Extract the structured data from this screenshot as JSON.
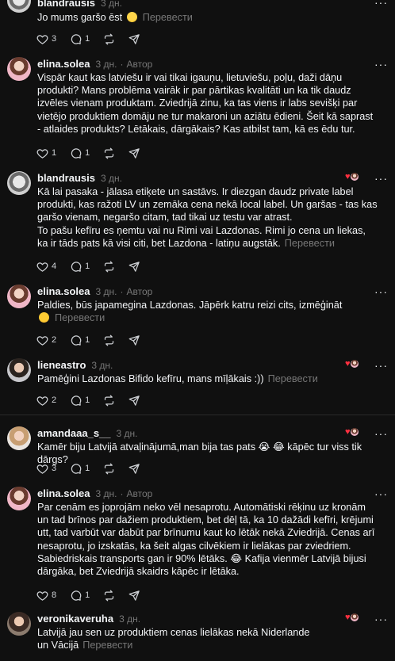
{
  "comments": [
    {
      "username": "blandrausis",
      "time": "3 дн.",
      "text": "Jo mums garšo ēst 🥹",
      "translate": "Перевести",
      "likes": "3",
      "replies": "1",
      "liked_by_author": false
    },
    {
      "username": "elina.solea",
      "time": "3 дн.",
      "author_tag": "Автор",
      "text": "Vispār kaut kas latviešu ir vai tikai igauņu, lietuviešu, poļu, daži dāņu produkti? Mans problēma vairāk ir par pārtikas kvalitāti un ka tik daudz izvēles vienam produktam. Zviedrijā zinu, ka tas viens ir labs sevišķi par vietējo produktiem domāju ne tur makaroni un aziātu ēdieni. Šeit kā saprast - atlaides produkts? Lētākais, dārgākais? Kas atbilst tam, kā es ēdu tur.",
      "likes": "1",
      "replies": "1",
      "liked_by_author": false
    },
    {
      "username": "blandrausis",
      "time": "3 дн.",
      "text": "Kā lai pasaka - jālasa etiķete un sastāvs. Ir diezgan daudz private label produkti, kas ražoti LV un zemāka cena nekā local label. Un garšas - tas kas garšo vienam, negaršo citam, tad tikai uz testu var atrast.\nTo pašu kefīru es ņemtu vai nu Rimi vai Lazdonas. Rimi jo cena un liekas, ka ir tāds pats kā visi citi, bet Lazdona - latiņu augstāk.",
      "translate": "Перевести",
      "likes": "4",
      "replies": "1",
      "liked_by_author": true
    },
    {
      "username": "elina.solea",
      "time": "3 дн.",
      "author_tag": "Автор",
      "text": "Paldies, būs japamegina Lazdonas. Jāpērk katru reizi cits, izmēģināt",
      "translate": "Перевести",
      "likes": "2",
      "replies": "1",
      "liked_by_author": false
    },
    {
      "username": "lieneastro",
      "time": "3 дн.",
      "text": "Pamēģini Lazdonas Bifido kefīru, mans mīļākais :))",
      "translate": "Перевести",
      "likes": "2",
      "replies": "1",
      "liked_by_author": true
    },
    {
      "username": "amandaaa_s__",
      "time": "3 дн.",
      "text": "Kamēr biju Latvijā atvaļinājumā,man bija tas pats 😭 😂 kāpēc tur viss tik dārgs?",
      "likes": "3",
      "replies": "1",
      "liked_by_author": true
    },
    {
      "username": "elina.solea",
      "time": "3 дн.",
      "author_tag": "Автор",
      "text": "Par cenām es joprojām neko vēl nesaprotu. Automātiski rēķinu uz kronām un tad brīnos par dažiem produktiem, bet dēļ tā, ka 10 dažādi kefīri, krējumi utt, tad varbūt var dabūt par brīnumu kaut ko lētāk nekā Zviedrijā. Cenas arī nesaprotu, jo izskatās, ka šeit algas cilvēkiem ir lielākas par zviedriem. Sabiedriskais transports gan ir 90% lētāks. 😂 Kafija vienmēr Latvijā bijusi dārgāka, bet Zviedrijā skaidrs kāpēc ir lētāka.",
      "likes": "8",
      "replies": "1",
      "liked_by_author": false
    },
    {
      "username": "veronikaveruha",
      "time": "3 дн.",
      "text": "Latvijā jau sen uz produktiem cenas lielākas nekā Niderlande un Vācijā",
      "translate": "Перевести",
      "liked_by_author": true
    }
  ],
  "icons": {
    "like": "heart-icon",
    "reply": "comment-icon",
    "repost": "repost-icon",
    "share": "share-icon",
    "more": "more-icon"
  },
  "colors": {
    "background": "#101010",
    "text": "#f3f5f7",
    "muted": "#777777",
    "like_red": "#ff3040"
  }
}
